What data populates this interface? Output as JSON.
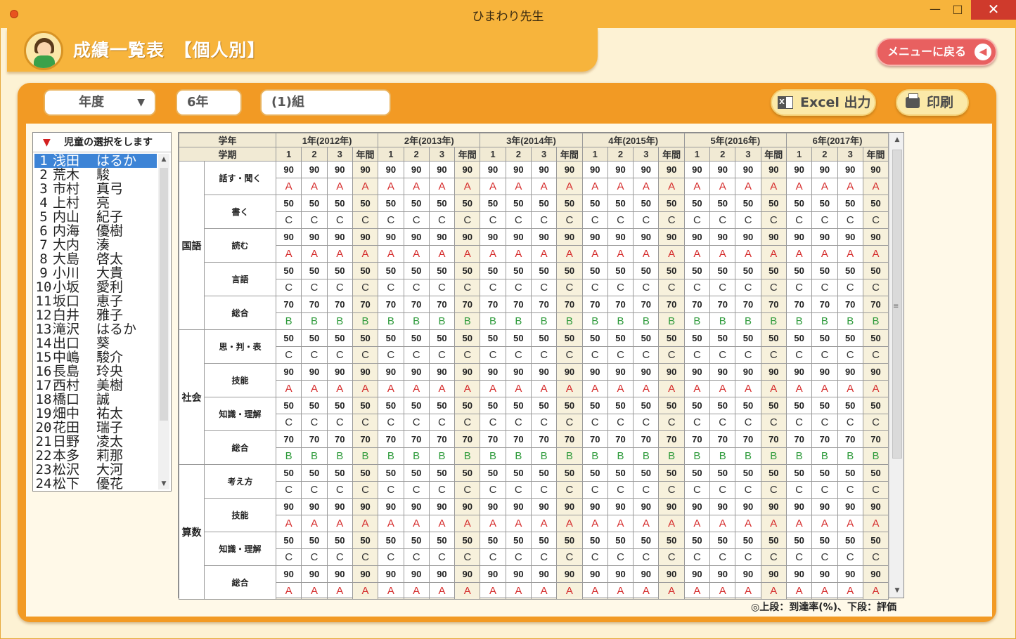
{
  "window": {
    "title": "ひまわり先生",
    "min": "—",
    "max": "□",
    "close": "✕"
  },
  "header": {
    "title": "成績一覧表　【個人別】",
    "menu_button": "メニューに戻る",
    "back_icon": "arrow-left"
  },
  "filters": {
    "year_label": "年度",
    "grade": "6年",
    "class": "(1)組"
  },
  "actions": {
    "excel": "Excel 出力",
    "print": "印刷"
  },
  "student_list": {
    "header": "児童の選択をします",
    "selected_index": 0,
    "students": [
      {
        "no": "1",
        "family": "浅田",
        "given": "はるか"
      },
      {
        "no": "2",
        "family": "荒木",
        "given": "駿"
      },
      {
        "no": "3",
        "family": "市村",
        "given": "真弓"
      },
      {
        "no": "4",
        "family": "上村",
        "given": "亮"
      },
      {
        "no": "5",
        "family": "内山",
        "given": "紀子"
      },
      {
        "no": "6",
        "family": "内海",
        "given": "優樹"
      },
      {
        "no": "7",
        "family": "大内",
        "given": "湊"
      },
      {
        "no": "8",
        "family": "大島",
        "given": "啓太"
      },
      {
        "no": "9",
        "family": "小川",
        "given": "大貴"
      },
      {
        "no": "10",
        "family": "小坂",
        "given": "愛利"
      },
      {
        "no": "11",
        "family": "坂口",
        "given": "恵子"
      },
      {
        "no": "12",
        "family": "白井",
        "given": "雅子"
      },
      {
        "no": "13",
        "family": "滝沢",
        "given": "はるか"
      },
      {
        "no": "14",
        "family": "出口",
        "given": "葵"
      },
      {
        "no": "15",
        "family": "中嶋",
        "given": "駿介"
      },
      {
        "no": "16",
        "family": "長島",
        "given": "玲央"
      },
      {
        "no": "17",
        "family": "西村",
        "given": "美樹"
      },
      {
        "no": "18",
        "family": "橋口",
        "given": "誠"
      },
      {
        "no": "19",
        "family": "畑中",
        "given": "祐太"
      },
      {
        "no": "20",
        "family": "花田",
        "given": "瑞子"
      },
      {
        "no": "21",
        "family": "日野",
        "given": "凌太"
      },
      {
        "no": "22",
        "family": "本多",
        "given": "莉那"
      },
      {
        "no": "23",
        "family": "松沢",
        "given": "大河"
      },
      {
        "no": "24",
        "family": "松下",
        "given": "優花"
      }
    ]
  },
  "grid": {
    "row_header_grade": "学年",
    "row_header_term": "学期",
    "years": [
      "1年(2012年)",
      "2年(2013年)",
      "3年(2014年)",
      "4年(2015年)",
      "5年(2016年)",
      "6年(2017年)"
    ],
    "terms": [
      "1",
      "2",
      "3",
      "年間"
    ],
    "subjects": [
      {
        "name": "国語",
        "items": [
          {
            "label": "話す・聞く",
            "score": "90",
            "grade": "A"
          },
          {
            "label": "書く",
            "score": "50",
            "grade": "C"
          },
          {
            "label": "読む",
            "score": "90",
            "grade": "A"
          },
          {
            "label": "言語",
            "score": "50",
            "grade": "C"
          },
          {
            "label": "総合",
            "score": "70",
            "grade": "B"
          }
        ]
      },
      {
        "name": "社会",
        "items": [
          {
            "label": "思・判・表",
            "score": "50",
            "grade": "C"
          },
          {
            "label": "技能",
            "score": "90",
            "grade": "A"
          },
          {
            "label": "知識・理解",
            "score": "50",
            "grade": "C"
          },
          {
            "label": "総合",
            "score": "70",
            "grade": "B"
          }
        ]
      },
      {
        "name": "算数",
        "items": [
          {
            "label": "考え方",
            "score": "50",
            "grade": "C"
          },
          {
            "label": "技能",
            "score": "90",
            "grade": "A"
          },
          {
            "label": "知識・理解",
            "score": "50",
            "grade": "C"
          },
          {
            "label": "総合",
            "score": "90",
            "grade": "A"
          }
        ]
      }
    ],
    "grade_colors": {
      "A": "#d52b2b",
      "B": "#2d9a3a",
      "C": "#333333"
    }
  },
  "legend": "◎上段：到達率(%)、下段：評価"
}
